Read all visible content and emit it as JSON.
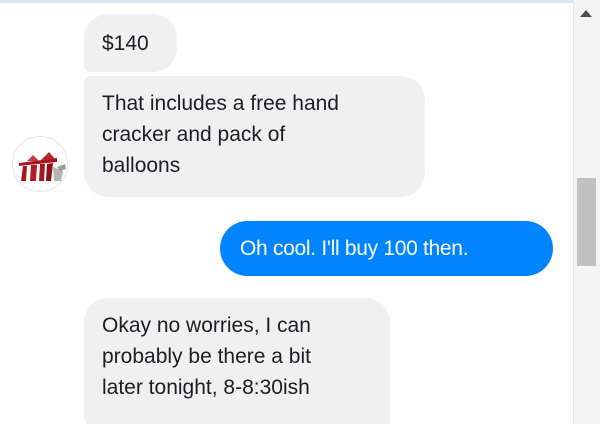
{
  "chat": {
    "messages": [
      {
        "sender": "other",
        "text": "$140"
      },
      {
        "sender": "other",
        "lines": [
          "That includes a free hand",
          "cracker and pack of",
          "balloons"
        ]
      },
      {
        "sender": "me",
        "text": "Oh cool. I'll buy 100 then."
      },
      {
        "sender": "other",
        "lines": [
          "Okay no worries, I can",
          "probably be there a bit",
          "later tonight, 8-8:30ish"
        ]
      }
    ]
  },
  "colors": {
    "sent_bubble": "#0084ff",
    "received_bubble": "#f1f0f0",
    "top_border": "#d6e6f5"
  },
  "icons": {
    "avatar": "contact-avatar-icon",
    "scroll_up": "chevron-up-icon"
  }
}
